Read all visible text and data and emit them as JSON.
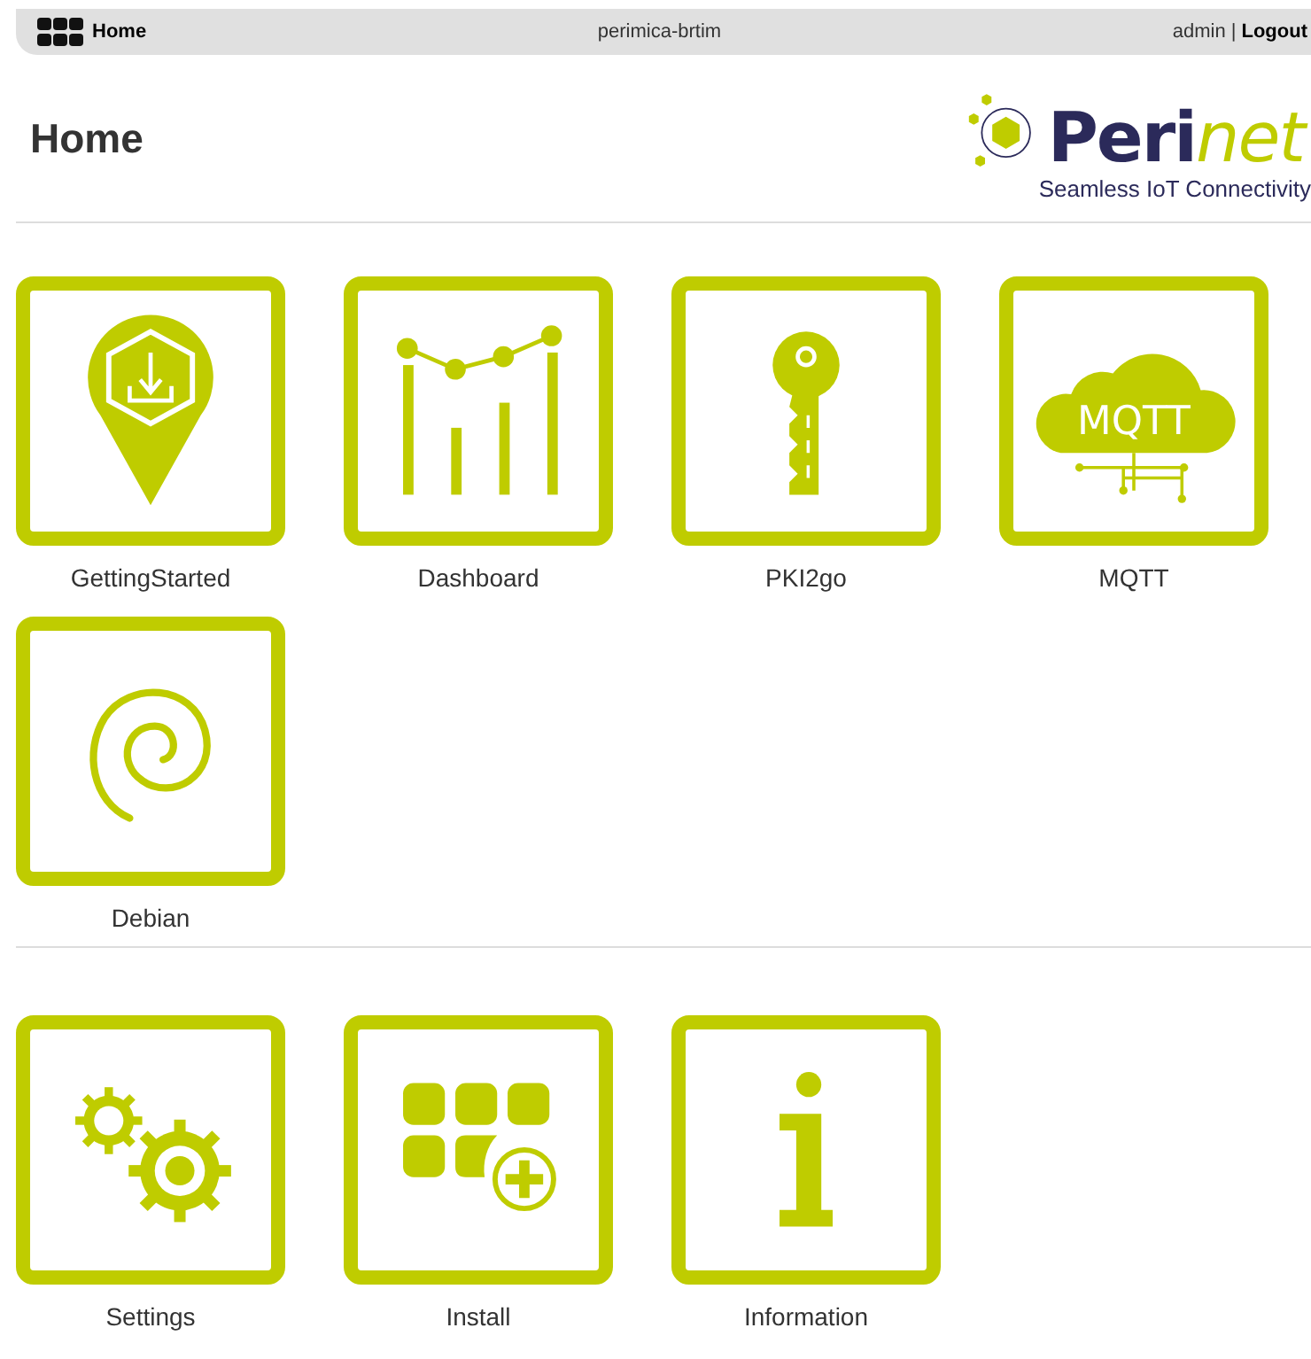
{
  "top_bar": {
    "home_link": "Home",
    "hostname": "perimica-brtim",
    "user": "admin",
    "separator": "|",
    "logout": "Logout"
  },
  "page_title": "Home",
  "logo": {
    "name_start": "Peri",
    "name_end": "net",
    "tagline": "Seamless IoT Connectivity"
  },
  "sections": [
    {
      "tiles": [
        {
          "label": "GettingStarted",
          "kind": "pin"
        },
        {
          "label": "Dashboard",
          "kind": "chart"
        },
        {
          "label": "PKI2go",
          "kind": "key"
        },
        {
          "label": "MQTT",
          "kind": "cloud",
          "icon_text": "MQTT"
        },
        {
          "label": "Debian",
          "kind": "spiral"
        }
      ]
    },
    {
      "tiles": [
        {
          "label": "Settings",
          "kind": "gears"
        },
        {
          "label": "Install",
          "kind": "apps"
        },
        {
          "label": "Information",
          "kind": "info"
        }
      ]
    }
  ]
}
